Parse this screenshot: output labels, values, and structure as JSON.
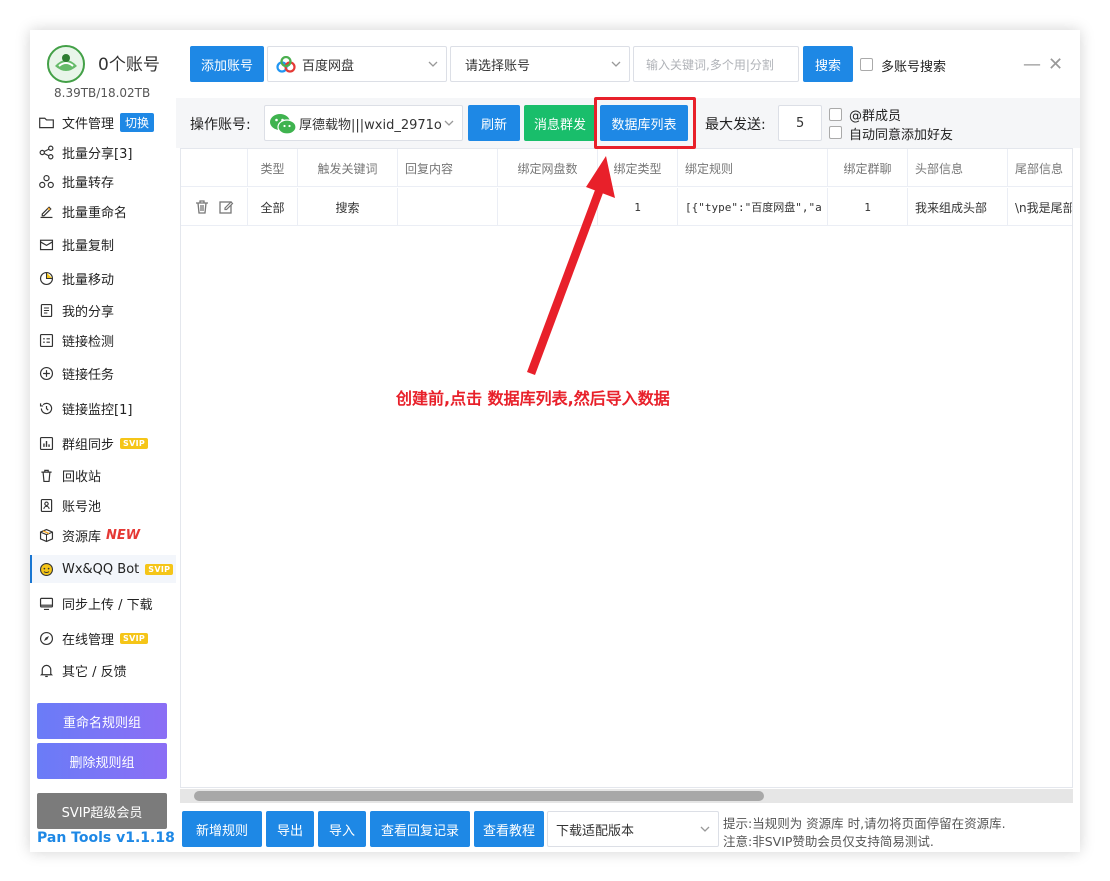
{
  "sidebar": {
    "account_count": "0个账号",
    "storage": "8.39TB/18.02TB",
    "items": [
      {
        "label": "文件管理",
        "badge": "切换"
      },
      {
        "label": "批量分享[3]"
      },
      {
        "label": "批量转存"
      },
      {
        "label": "批量重命名"
      },
      {
        "label": "批量复制"
      },
      {
        "label": "批量移动"
      },
      {
        "label": "我的分享"
      },
      {
        "label": "链接检测"
      },
      {
        "label": "链接任务"
      },
      {
        "label": "链接监控[1]"
      },
      {
        "label": "群组同步",
        "badge": "SVIP"
      },
      {
        "label": "回收站"
      },
      {
        "label": "账号池"
      },
      {
        "label": "资源库",
        "badge": "NEW"
      },
      {
        "label": "Wx&QQ Bot",
        "badge": "SVIP"
      },
      {
        "label": "同步上传 / 下载"
      },
      {
        "label": "在线管理",
        "badge": "SVIP"
      },
      {
        "label": "其它 / 反馈"
      }
    ],
    "rename_rules": "重命名规则组",
    "delete_rules": "删除规则组",
    "svip_member": "SVIP超级会员",
    "version": "Pan Tools v1.1.18"
  },
  "topbar": {
    "add_account": "添加账号",
    "disk_select": "百度网盘",
    "account_select": "请选择账号",
    "keyword_placeholder": "输入关键词,多个用|分割",
    "search": "搜索",
    "multi_search": "多账号搜索"
  },
  "opbar": {
    "op_account_label": "操作账号:",
    "op_account_value": "厚德载物|||wxid_2971o",
    "refresh": "刷新",
    "broadcast": "消息群发",
    "db_list": "数据库列表",
    "max_send_label": "最大发送:",
    "max_send_value": "5",
    "at_members": "@群成员",
    "auto_accept": "自动同意添加好友"
  },
  "table": {
    "headers": [
      "",
      "类型",
      "触发关键词",
      "回复内容",
      "绑定网盘数",
      "绑定类型",
      "绑定规则",
      "绑定群聊",
      "头部信息",
      "尾部信息"
    ],
    "rows": [
      {
        "type": "全部",
        "keyword": "搜索",
        "reply": "",
        "disk_count": "",
        "bind_type": "1",
        "bind_rule": "[{\"type\":\"百度网盘\",\"a",
        "bind_group": "1",
        "header": "我来组成头部",
        "footer": "\\n我是尾部"
      }
    ]
  },
  "bottom": {
    "add_rule": "新增规则",
    "export": "导出",
    "import": "导入",
    "view_reply_log": "查看回复记录",
    "view_tutorial": "查看教程",
    "download_select": "下载适配版本",
    "tip1": "提示:当规则为 资源库 时,请勿将页面停留在资源库.",
    "tip2": "注意:非SVIP赞助会员仅支持简易测试."
  },
  "annotation": "创建前,点击 数据库列表,然后导入数据",
  "colors": {
    "primary": "#1e88e5",
    "green": "#19be6b",
    "annotation": "#e8202a",
    "svip": "#f5c518"
  }
}
